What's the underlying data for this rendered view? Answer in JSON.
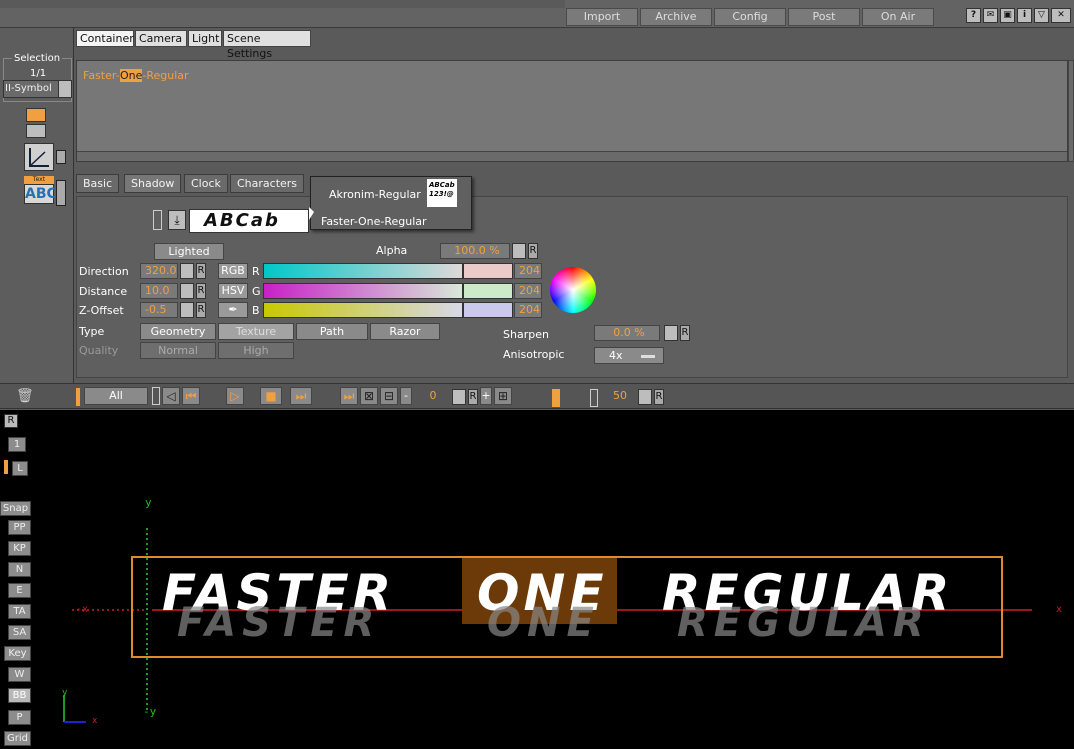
{
  "topbar": {
    "buttons": [
      "Import",
      "Archive",
      "Config",
      "Post",
      "On Air"
    ]
  },
  "tabs": [
    "Container",
    "Camera",
    "Light",
    "Scene Settings"
  ],
  "left_panel": {
    "selection_label": "Selection",
    "selection_count": "1/1",
    "selection_value": "II-Symbol",
    "text_icon_label": "Text",
    "text_icon_glyph": "ABC"
  },
  "editor": {
    "text_before": "Faster-",
    "text_highlight": "One",
    "text_after": "-Regular"
  },
  "subtabs": [
    "Basic",
    "Shadow",
    "Clock",
    "Characters"
  ],
  "dropdown": {
    "items": [
      "Akronim-Regular",
      "Faster-One-Regular"
    ],
    "preview_text": "ABCab 123!@"
  },
  "shadow": {
    "font_preview": "ABCab",
    "lighted_label": "Lighted",
    "alpha_label": "Alpha",
    "alpha_value": "100.0 %",
    "direction_label": "Direction",
    "direction_value": "320.0",
    "distance_label": "Distance",
    "distance_value": "10.0",
    "zoffset_label": "Z-Offset",
    "zoffset_value": "-0.5",
    "rgb_label": "RGB",
    "hsv_label": "HSV",
    "r_label": "R",
    "g_label": "G",
    "b_label": "B",
    "r_value": "204",
    "g_value": "204",
    "b_value": "204",
    "type_label": "Type",
    "type_options": [
      "Geometry",
      "Texture",
      "Path",
      "Razor"
    ],
    "type_selected": "Texture",
    "quality_label": "Quality",
    "quality_options": [
      "Normal",
      "High"
    ],
    "sharpen_label": "Sharpen",
    "sharpen_value": "0.0 %",
    "anisotropic_label": "Anisotropic",
    "anisotropic_value": "4x",
    "r_button": "R"
  },
  "timeline": {
    "all_label": "All",
    "frame_value": "0",
    "end_value": "50",
    "r_label": "R",
    "plus_label": "+",
    "minus_label": "-"
  },
  "side_buttons": [
    "1",
    "L",
    "Snap",
    "PP",
    "KP",
    "N",
    "E",
    "TA",
    "SA",
    "Key",
    "W",
    "BB",
    "P",
    "Grid"
  ],
  "viewport": {
    "display_text_1": "FASTER",
    "display_text_2": "ONE",
    "display_text_3": "REGULAR",
    "axis_y": "y",
    "axis_x": "x",
    "axis_neg_x": "-x",
    "axis_neg_y": "-y"
  },
  "colors": {
    "accent": "#f0a040",
    "selection_box": "#e08a2c",
    "highlight_box": "#6b3a08"
  }
}
